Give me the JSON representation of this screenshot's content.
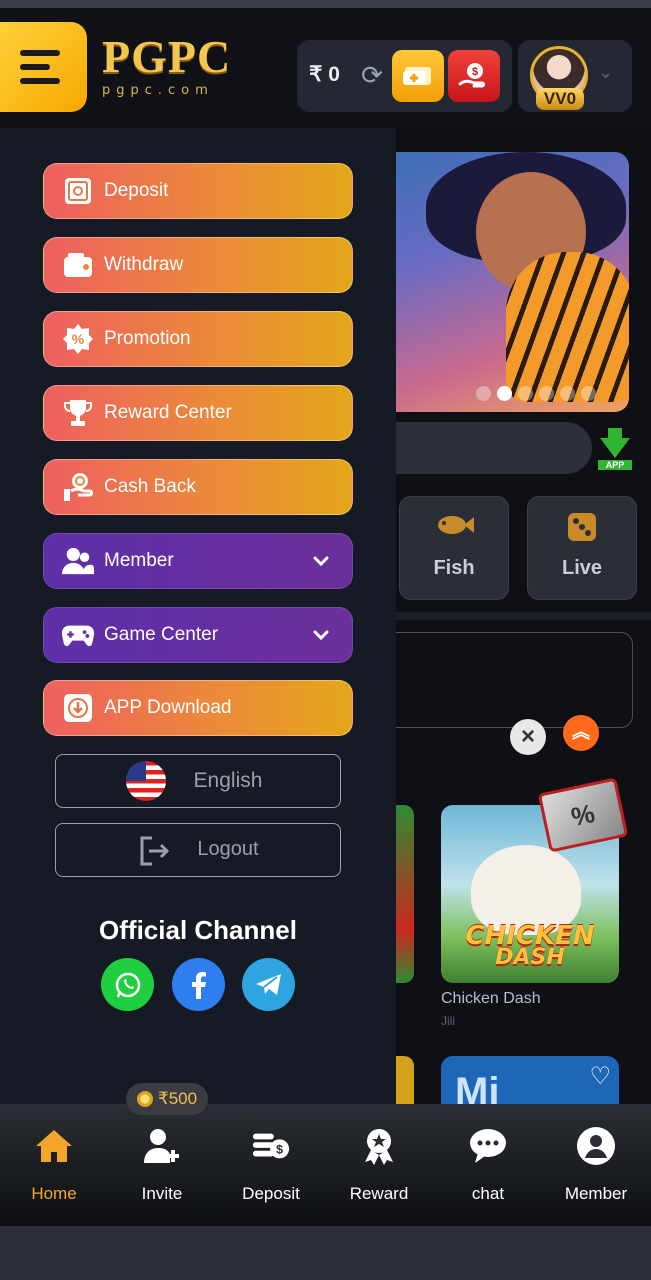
{
  "header": {
    "logo_main": "PGPC",
    "logo_sub": "pgpc.com",
    "balance": "₹ 0",
    "vip_level": "VV0"
  },
  "drawer": {
    "items": [
      {
        "label": "Deposit",
        "icon": "safe-icon",
        "style": "orange"
      },
      {
        "label": "Withdraw",
        "icon": "wallet-icon",
        "style": "orange"
      },
      {
        "label": "Promotion",
        "icon": "percent-badge-icon",
        "style": "orange"
      },
      {
        "label": "Reward Center",
        "icon": "trophy-icon",
        "style": "orange"
      },
      {
        "label": "Cash Back",
        "icon": "hand-coin-icon",
        "style": "orange"
      },
      {
        "label": "Member",
        "icon": "users-icon",
        "style": "purple",
        "expandable": true
      },
      {
        "label": "Game Center",
        "icon": "gamepad-icon",
        "style": "purple",
        "expandable": true
      },
      {
        "label": "APP Download",
        "icon": "download-icon",
        "style": "orange"
      }
    ],
    "language": "English",
    "logout": "Logout",
    "channel_title": "Official Channel",
    "channels": [
      "whatsapp-icon",
      "facebook-icon",
      "telegram-icon"
    ]
  },
  "background": {
    "categories": [
      {
        "label": "Fish",
        "icon": "fish-icon"
      },
      {
        "label": "Live",
        "icon": "dice-icon"
      }
    ],
    "app_label": "APP",
    "game": {
      "name": "Chicken Dash",
      "title_line1": "CHICKEN",
      "title_line2": "DASH",
      "provider": "Jili"
    },
    "game2_text": "Mi",
    "promo_tag": "%"
  },
  "invite_badge": "₹500",
  "bottom_nav": [
    {
      "label": "Home",
      "icon": "home-icon",
      "active": true
    },
    {
      "label": "Invite",
      "icon": "add-user-icon",
      "active": false
    },
    {
      "label": "Deposit",
      "icon": "coins-icon",
      "active": false
    },
    {
      "label": "Reward",
      "icon": "medal-icon",
      "active": false
    },
    {
      "label": "chat",
      "icon": "chat-icon",
      "active": false
    },
    {
      "label": "Member",
      "icon": "user-icon",
      "active": false
    }
  ],
  "colors": {
    "accent_gold": "#f4a62a",
    "menu_orange_start": "#ee6060",
    "menu_orange_end": "#e4a61a",
    "menu_purple": "#5d2fa8",
    "drawer_bg": "#161a24"
  }
}
